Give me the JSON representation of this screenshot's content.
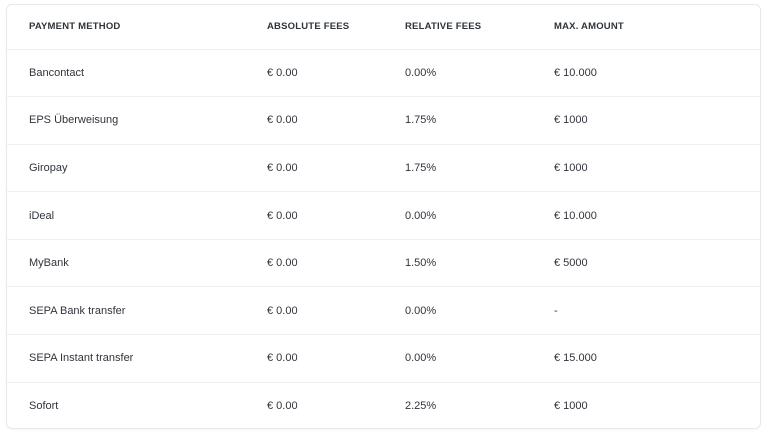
{
  "table": {
    "headers": [
      "PAYMENT METHOD",
      "ABSOLUTE FEES",
      "RELATIVE FEES",
      "MAX. AMOUNT"
    ],
    "rows": [
      {
        "method": "Bancontact",
        "absolute": "€ 0.00",
        "relative": "0.00%",
        "max": "€ 10.000"
      },
      {
        "method": "EPS Überweisung",
        "absolute": "€ 0.00",
        "relative": "1.75%",
        "max": "€ 1000"
      },
      {
        "method": "Giropay",
        "absolute": "€ 0.00",
        "relative": "1.75%",
        "max": "€ 1000"
      },
      {
        "method": "iDeal",
        "absolute": "€ 0.00",
        "relative": "0.00%",
        "max": "€ 10.000"
      },
      {
        "method": "MyBank",
        "absolute": "€ 0.00",
        "relative": "1.50%",
        "max": "€ 5000"
      },
      {
        "method": "SEPA Bank transfer",
        "absolute": "€ 0.00",
        "relative": "0.00%",
        "max": "-"
      },
      {
        "method": "SEPA Instant transfer",
        "absolute": "€ 0.00",
        "relative": "0.00%",
        "max": "€ 15.000"
      },
      {
        "method": "Sofort",
        "absolute": "€ 0.00",
        "relative": "2.25%",
        "max": "€ 1000"
      }
    ]
  }
}
